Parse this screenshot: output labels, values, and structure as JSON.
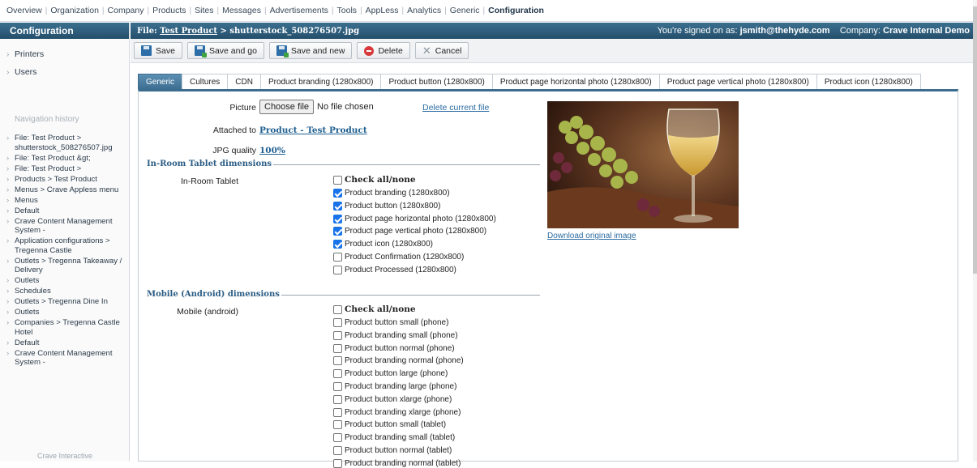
{
  "topnav": {
    "items": [
      "Overview",
      "Organization",
      "Company",
      "Products",
      "Sites",
      "Messages",
      "Advertisements",
      "Tools",
      "AppLess",
      "Analytics",
      "Generic",
      "Configuration"
    ],
    "active": "Configuration"
  },
  "sidebar": {
    "title": "Configuration",
    "items": [
      "Printers",
      "Users"
    ],
    "history_title": "Navigation history",
    "history": [
      "File: Test Product > shutterstock_508276507.jpg",
      "File: Test Product &gt;",
      "File: Test Product >",
      "Products > Test Product",
      "Menus > Crave Appless menu",
      "Menus",
      "Default",
      "Crave Content Management System -",
      "Application configurations > Tregenna Castle",
      "Outlets > Tregenna Takeaway / Delivery",
      "Outlets",
      "Schedules",
      "Outlets > Tregenna Dine In",
      "Outlets",
      "Companies > Tregenna Castle Hotel",
      "Default",
      "Crave Content Management System -"
    ],
    "footer": "Crave Interactive"
  },
  "header": {
    "crumb_prefix": "File: ",
    "crumb_link": "Test Product",
    "crumb_suffix": " > shutterstock_508276507.jpg",
    "signed_label": "You're signed on as: ",
    "user": "jsmith@thehyde.com",
    "company_label": "Company: ",
    "company": "Crave Internal Demo"
  },
  "toolbar": {
    "save": "Save",
    "save_go": "Save and go",
    "save_new": "Save and new",
    "delete": "Delete",
    "cancel": "Cancel"
  },
  "tabs": [
    "Generic",
    "Cultures",
    "CDN",
    "Product branding (1280x800)",
    "Product button (1280x800)",
    "Product page horizontal photo (1280x800)",
    "Product page vertical photo (1280x800)",
    "Product icon (1280x800)"
  ],
  "form": {
    "picture_label": "Picture",
    "choose_file": "Choose file",
    "no_file": "No file chosen",
    "delete_current": "Delete current file",
    "attached_label": "Attached to",
    "attached_value": "Product - Test Product",
    "jpg_label": "JPG quality",
    "jpg_value": "100%",
    "download": "Download original image"
  },
  "tablet": {
    "legend": "In-Room Tablet dimensions",
    "label": "In-Room Tablet",
    "check_all": "Check all/none",
    "options": [
      {
        "label": "Product branding (1280x800)",
        "checked": true
      },
      {
        "label": "Product button (1280x800)",
        "checked": true
      },
      {
        "label": "Product page horizontal photo (1280x800)",
        "checked": true
      },
      {
        "label": "Product page vertical photo (1280x800)",
        "checked": true
      },
      {
        "label": "Product icon (1280x800)",
        "checked": true
      },
      {
        "label": "Product Confirmation (1280x800)",
        "checked": false
      },
      {
        "label": "Product Processed (1280x800)",
        "checked": false
      }
    ]
  },
  "mobile": {
    "legend": "Mobile (Android) dimensions",
    "label": "Mobile (android)",
    "check_all": "Check all/none",
    "options": [
      {
        "label": "Product button small (phone)",
        "checked": false
      },
      {
        "label": "Product branding small (phone)",
        "checked": false
      },
      {
        "label": "Product button normal (phone)",
        "checked": false
      },
      {
        "label": "Product branding normal (phone)",
        "checked": false
      },
      {
        "label": "Product button large (phone)",
        "checked": false
      },
      {
        "label": "Product branding large (phone)",
        "checked": false
      },
      {
        "label": "Product button xlarge (phone)",
        "checked": false
      },
      {
        "label": "Product branding xlarge (phone)",
        "checked": false
      },
      {
        "label": "Product button small (tablet)",
        "checked": false
      },
      {
        "label": "Product branding small (tablet)",
        "checked": false
      },
      {
        "label": "Product button normal (tablet)",
        "checked": false
      },
      {
        "label": "Product branding normal (tablet)",
        "checked": false
      }
    ]
  }
}
